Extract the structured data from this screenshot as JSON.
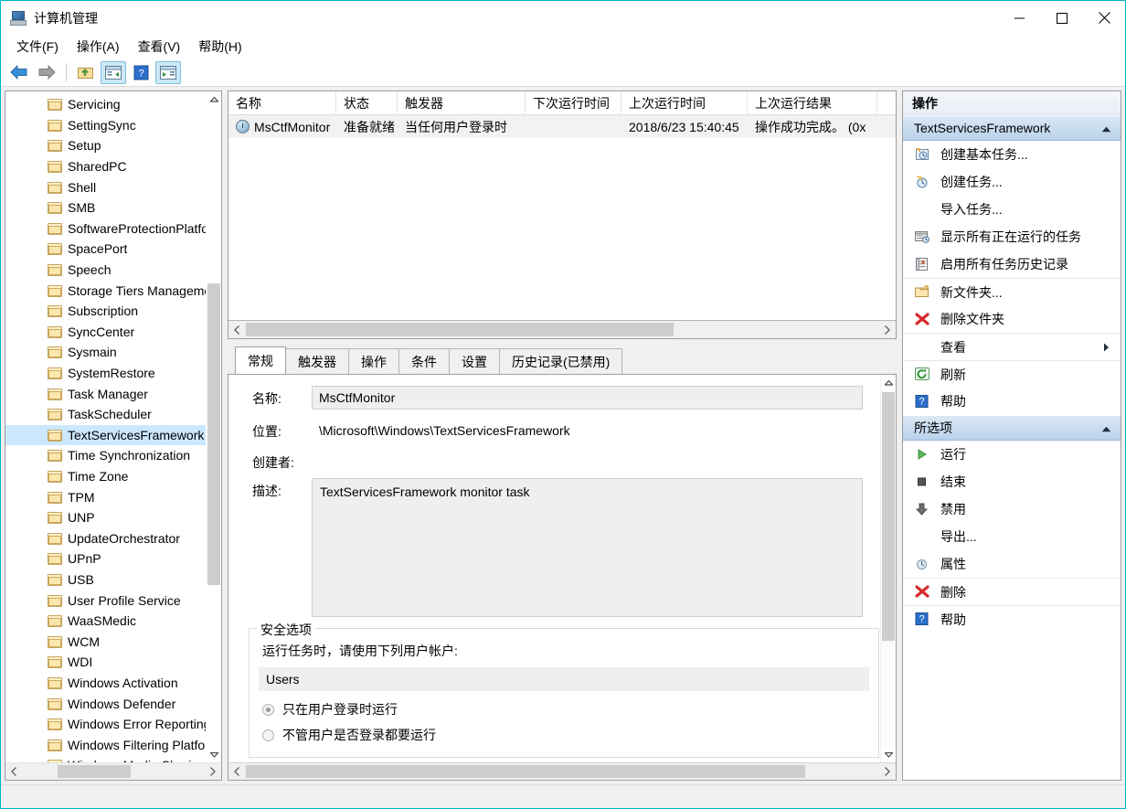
{
  "window": {
    "title": "计算机管理",
    "app_icon": "computer-management-icon",
    "accent_color": "#00b7c3",
    "controls": {
      "minimize": "最小化",
      "maximize": "最大化",
      "close": "关闭"
    }
  },
  "menubar": {
    "items": [
      {
        "label": "文件(F)",
        "name": "menu-file"
      },
      {
        "label": "操作(A)",
        "name": "menu-action"
      },
      {
        "label": "查看(V)",
        "name": "menu-view"
      },
      {
        "label": "帮助(H)",
        "name": "menu-help"
      }
    ]
  },
  "toolbar": {
    "buttons": [
      {
        "name": "back-button",
        "icon": "back-arrow-icon",
        "pressed": false
      },
      {
        "name": "forward-button",
        "icon": "forward-arrow-icon",
        "pressed": false
      },
      {
        "name": "up-folder-button",
        "icon": "folder-up-icon",
        "pressed": false
      },
      {
        "name": "show-console-tree-button",
        "icon": "console-tree-icon",
        "pressed": true
      },
      {
        "name": "help-button",
        "icon": "help-question-icon",
        "pressed": false
      },
      {
        "name": "show-action-pane-button",
        "icon": "action-pane-icon",
        "pressed": true
      }
    ]
  },
  "tree": {
    "selected": "TextServicesFramework",
    "items": [
      "Servicing",
      "SettingSync",
      "Setup",
      "SharedPC",
      "Shell",
      "SMB",
      "SoftwareProtectionPlatform",
      "SpacePort",
      "Speech",
      "Storage Tiers Management",
      "Subscription",
      "SyncCenter",
      "Sysmain",
      "SystemRestore",
      "Task Manager",
      "TaskScheduler",
      "TextServicesFramework",
      "Time Synchronization",
      "Time Zone",
      "TPM",
      "UNP",
      "UpdateOrchestrator",
      "UPnP",
      "USB",
      "User Profile Service",
      "WaaSMedic",
      "WCM",
      "WDI",
      "Windows Activation",
      "Windows Defender",
      "Windows Error Reporting",
      "Windows Filtering Platform",
      "Windows Media Sharing"
    ]
  },
  "task_list": {
    "columns": [
      {
        "label": "名称",
        "width": 118
      },
      {
        "label": "状态",
        "width": 67
      },
      {
        "label": "触发器",
        "width": 140
      },
      {
        "label": "下次运行时间",
        "width": 105
      },
      {
        "label": "上次运行时间",
        "width": 138
      },
      {
        "label": "上次运行结果",
        "width": 142
      }
    ],
    "rows": [
      {
        "icon": "clock-icon",
        "name": "MsCtfMonitor",
        "status": "准备就绪",
        "trigger": "当任何用户登录时",
        "next_run": "",
        "last_run": "2018/6/23 15:40:45",
        "last_result": "操作成功完成。 (0x"
      }
    ]
  },
  "details": {
    "tabs": [
      {
        "label": "常规",
        "active": true
      },
      {
        "label": "触发器",
        "active": false
      },
      {
        "label": "操作",
        "active": false
      },
      {
        "label": "条件",
        "active": false
      },
      {
        "label": "设置",
        "active": false
      },
      {
        "label": "历史记录(已禁用)",
        "active": false
      }
    ],
    "general": {
      "name_label": "名称:",
      "name_value": "MsCtfMonitor",
      "location_label": "位置:",
      "location_value": "\\Microsoft\\Windows\\TextServicesFramework",
      "author_label": "创建者:",
      "author_value": "",
      "description_label": "描述:",
      "description_value": "TextServicesFramework monitor task"
    },
    "security": {
      "legend": "安全选项",
      "caption": "运行任务时，请使用下列用户帐户:",
      "account": "Users",
      "options": [
        {
          "label": "只在用户登录时运行",
          "checked": true
        },
        {
          "label": "不管用户是否登录都要运行",
          "checked": false
        }
      ]
    }
  },
  "actions_pane": {
    "title": "操作",
    "groups": [
      {
        "header": "TextServicesFramework",
        "collapse_icon": "chevron-up-icon",
        "items": [
          {
            "label": "创建基本任务...",
            "icon": "create-basic-task-icon",
            "sep": false
          },
          {
            "label": "创建任务...",
            "icon": "create-task-icon",
            "sep": false
          },
          {
            "label": "导入任务...",
            "icon": "none",
            "sep": false
          },
          {
            "label": "显示所有正在运行的任务",
            "icon": "running-tasks-icon",
            "sep": false
          },
          {
            "label": "启用所有任务历史记录",
            "icon": "task-history-icon",
            "sep": false
          },
          {
            "label": "新文件夹...",
            "icon": "new-folder-icon",
            "sep": true
          },
          {
            "label": "删除文件夹",
            "icon": "delete-x-icon",
            "sep": false
          },
          {
            "label": "查看",
            "icon": "none",
            "sep": true,
            "submenu": "▶"
          },
          {
            "label": "刷新",
            "icon": "refresh-icon",
            "sep": true
          },
          {
            "label": "帮助",
            "icon": "help-question-icon",
            "sep": false
          }
        ]
      },
      {
        "header": "所选项",
        "collapse_icon": "chevron-up-icon",
        "items": [
          {
            "label": "运行",
            "icon": "run-play-icon",
            "sep": false
          },
          {
            "label": "结束",
            "icon": "stop-square-icon",
            "sep": false
          },
          {
            "label": "禁用",
            "icon": "disable-down-arrow-icon",
            "sep": false
          },
          {
            "label": "导出...",
            "icon": "none",
            "sep": false
          },
          {
            "label": "属性",
            "icon": "properties-clock-icon",
            "sep": false
          },
          {
            "label": "删除",
            "icon": "delete-x-icon",
            "sep": true
          },
          {
            "label": "帮助",
            "icon": "help-question-icon",
            "sep": true
          }
        ]
      }
    ]
  },
  "statusbar": {
    "text": ""
  }
}
